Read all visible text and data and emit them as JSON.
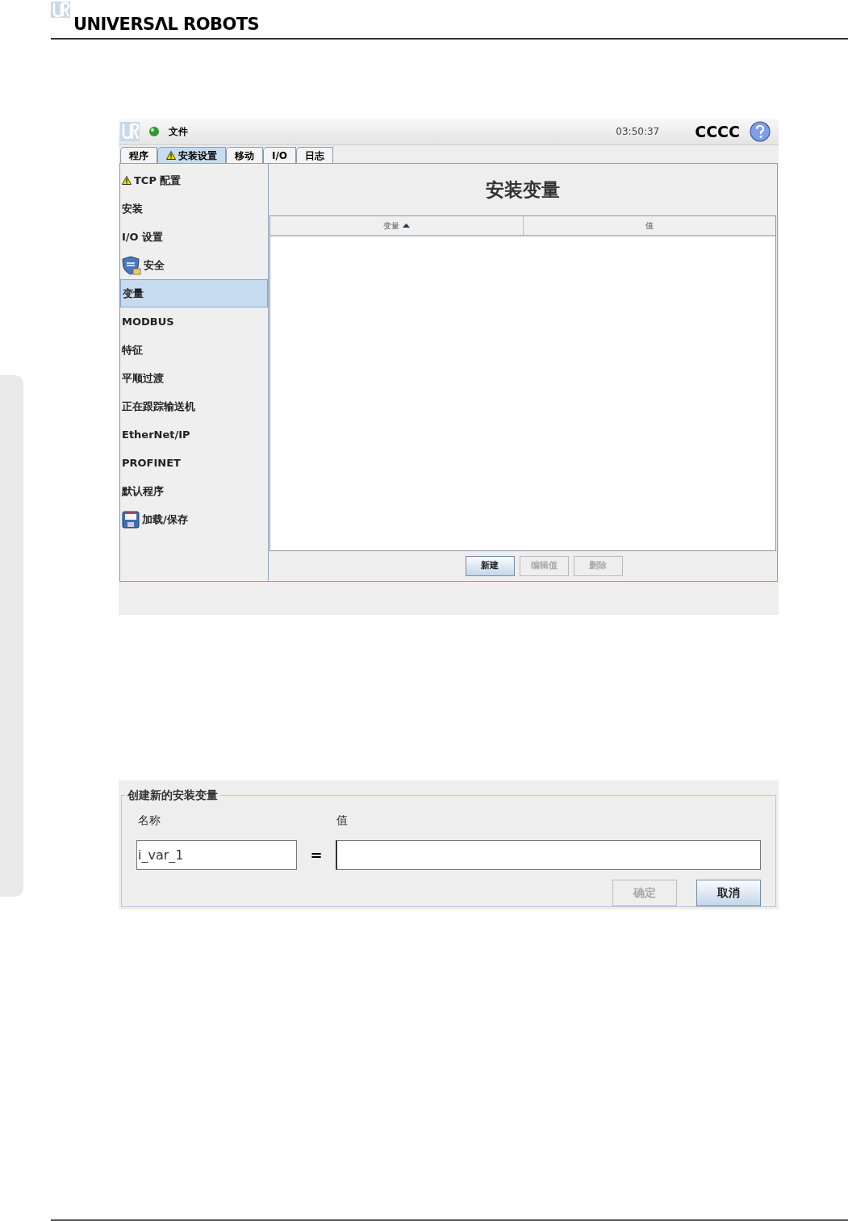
{
  "header": {
    "brand": "UNIVERSΛL ROBOTS"
  },
  "app": {
    "menu": "文件",
    "time": "03:50:37",
    "robot": "CCCC",
    "tabs": [
      {
        "label": "程序",
        "selected": false,
        "warning": false
      },
      {
        "label": "安装设置",
        "selected": true,
        "warning": true
      },
      {
        "label": "移动",
        "selected": false,
        "warning": false
      },
      {
        "label": "I/O",
        "selected": false,
        "warning": false
      },
      {
        "label": "日志",
        "selected": false,
        "warning": false
      }
    ],
    "sidebar": {
      "items": [
        {
          "label": "TCP 配置",
          "kind": "warning",
          "selected": false
        },
        {
          "label": "安装",
          "selected": false
        },
        {
          "label": "I/O 设置",
          "selected": false
        },
        {
          "label": "安全",
          "kind": "shield",
          "selected": false
        },
        {
          "label": "变量",
          "selected": true
        },
        {
          "label": "MODBUS",
          "selected": false
        },
        {
          "label": "特征",
          "selected": false
        },
        {
          "label": "平顺过渡",
          "selected": false
        },
        {
          "label": "正在跟踪输送机",
          "selected": false
        },
        {
          "label": "EtherNet/IP",
          "selected": false
        },
        {
          "label": "PROFINET",
          "selected": false
        },
        {
          "label": "默认程序",
          "selected": false
        },
        {
          "label": "加载/保存",
          "kind": "floppy",
          "selected": false
        }
      ]
    },
    "title": "安装变量",
    "table": {
      "columns": [
        {
          "label": "变量",
          "sorted": true
        },
        {
          "label": "值",
          "sorted": false
        }
      ]
    },
    "buttons": [
      {
        "label": "新建",
        "disabled": false
      },
      {
        "label": "编辑值",
        "disabled": true
      },
      {
        "label": "删除",
        "disabled": true
      }
    ]
  },
  "dialog": {
    "legend": "创建新的安装变量",
    "name_label": "名称",
    "value_label": "值",
    "name_value": "i_var_1",
    "equals": "=",
    "buttons": [
      {
        "label": "确定",
        "disabled": true
      },
      {
        "label": "取消",
        "disabled": false
      }
    ]
  }
}
